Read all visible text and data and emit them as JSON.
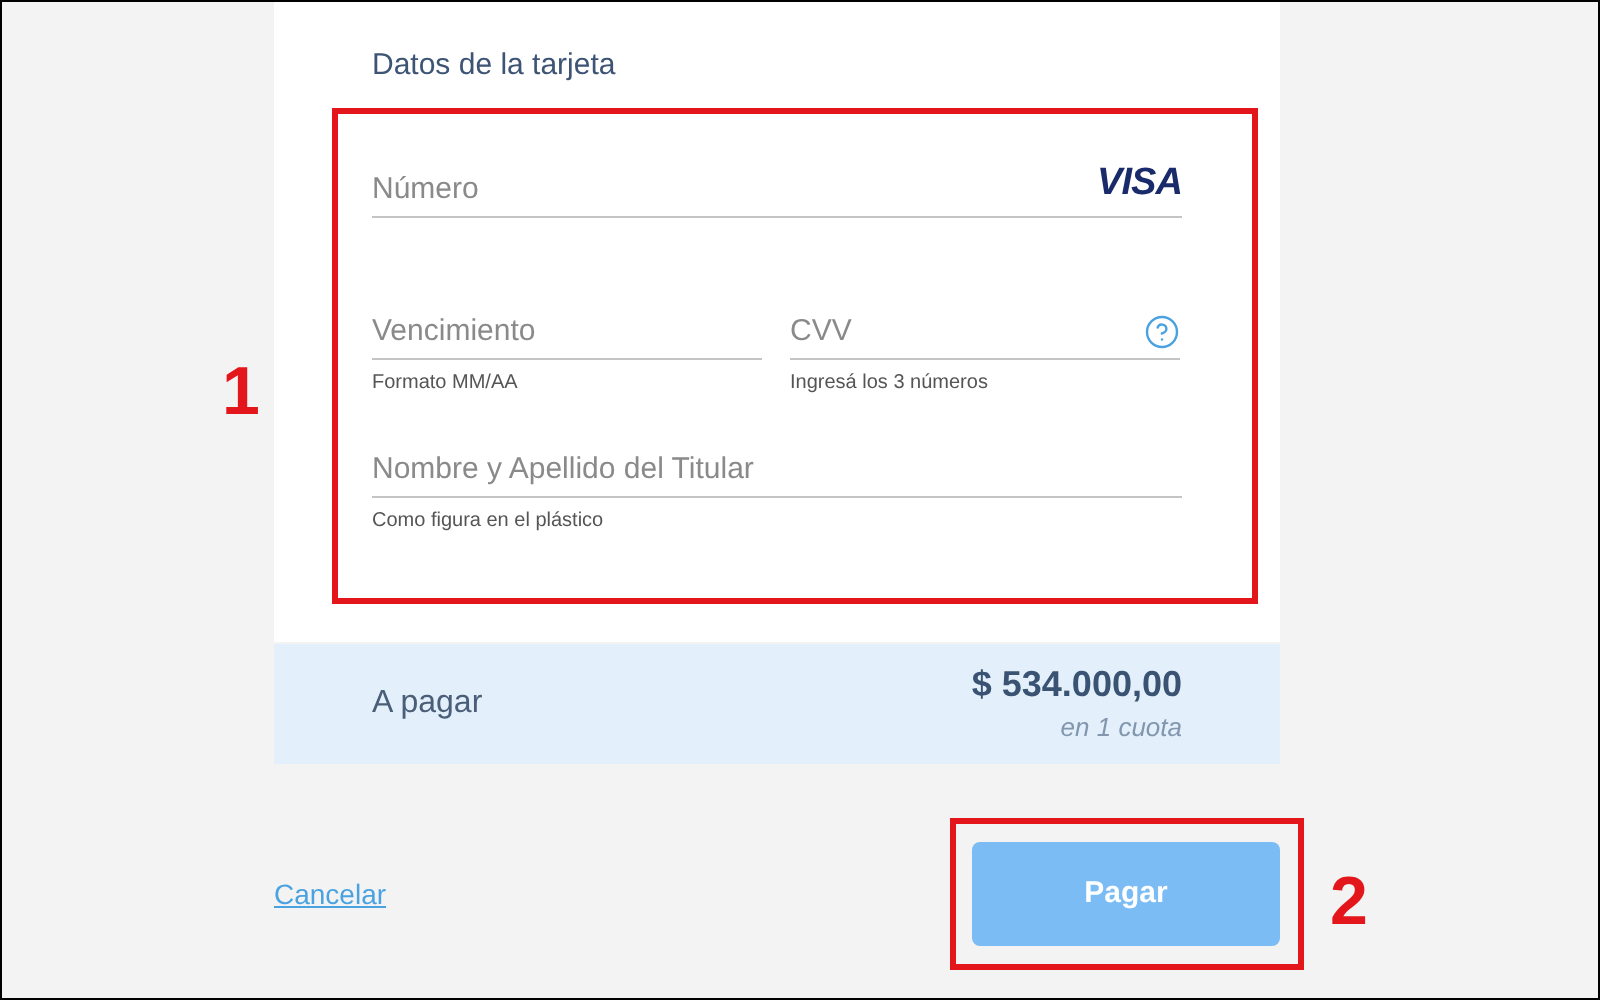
{
  "card_form": {
    "title": "Datos de la tarjeta",
    "number": {
      "placeholder": "Número",
      "brand": "VISA"
    },
    "expiry": {
      "placeholder": "Vencimiento",
      "hint": "Formato MM/AA"
    },
    "cvv": {
      "placeholder": "CVV",
      "hint": "Ingresá los 3 números"
    },
    "holder": {
      "placeholder": "Nombre y Apellido del Titular",
      "hint": "Como figura en el plástico"
    }
  },
  "summary": {
    "label": "A pagar",
    "amount": "$ 534.000,00",
    "installments": "en 1 cuota"
  },
  "actions": {
    "cancel": "Cancelar",
    "pay": {
      "label": "Pagar",
      "disabled": true
    }
  },
  "annotations": [
    {
      "label": "1"
    },
    {
      "label": "2"
    }
  ]
}
